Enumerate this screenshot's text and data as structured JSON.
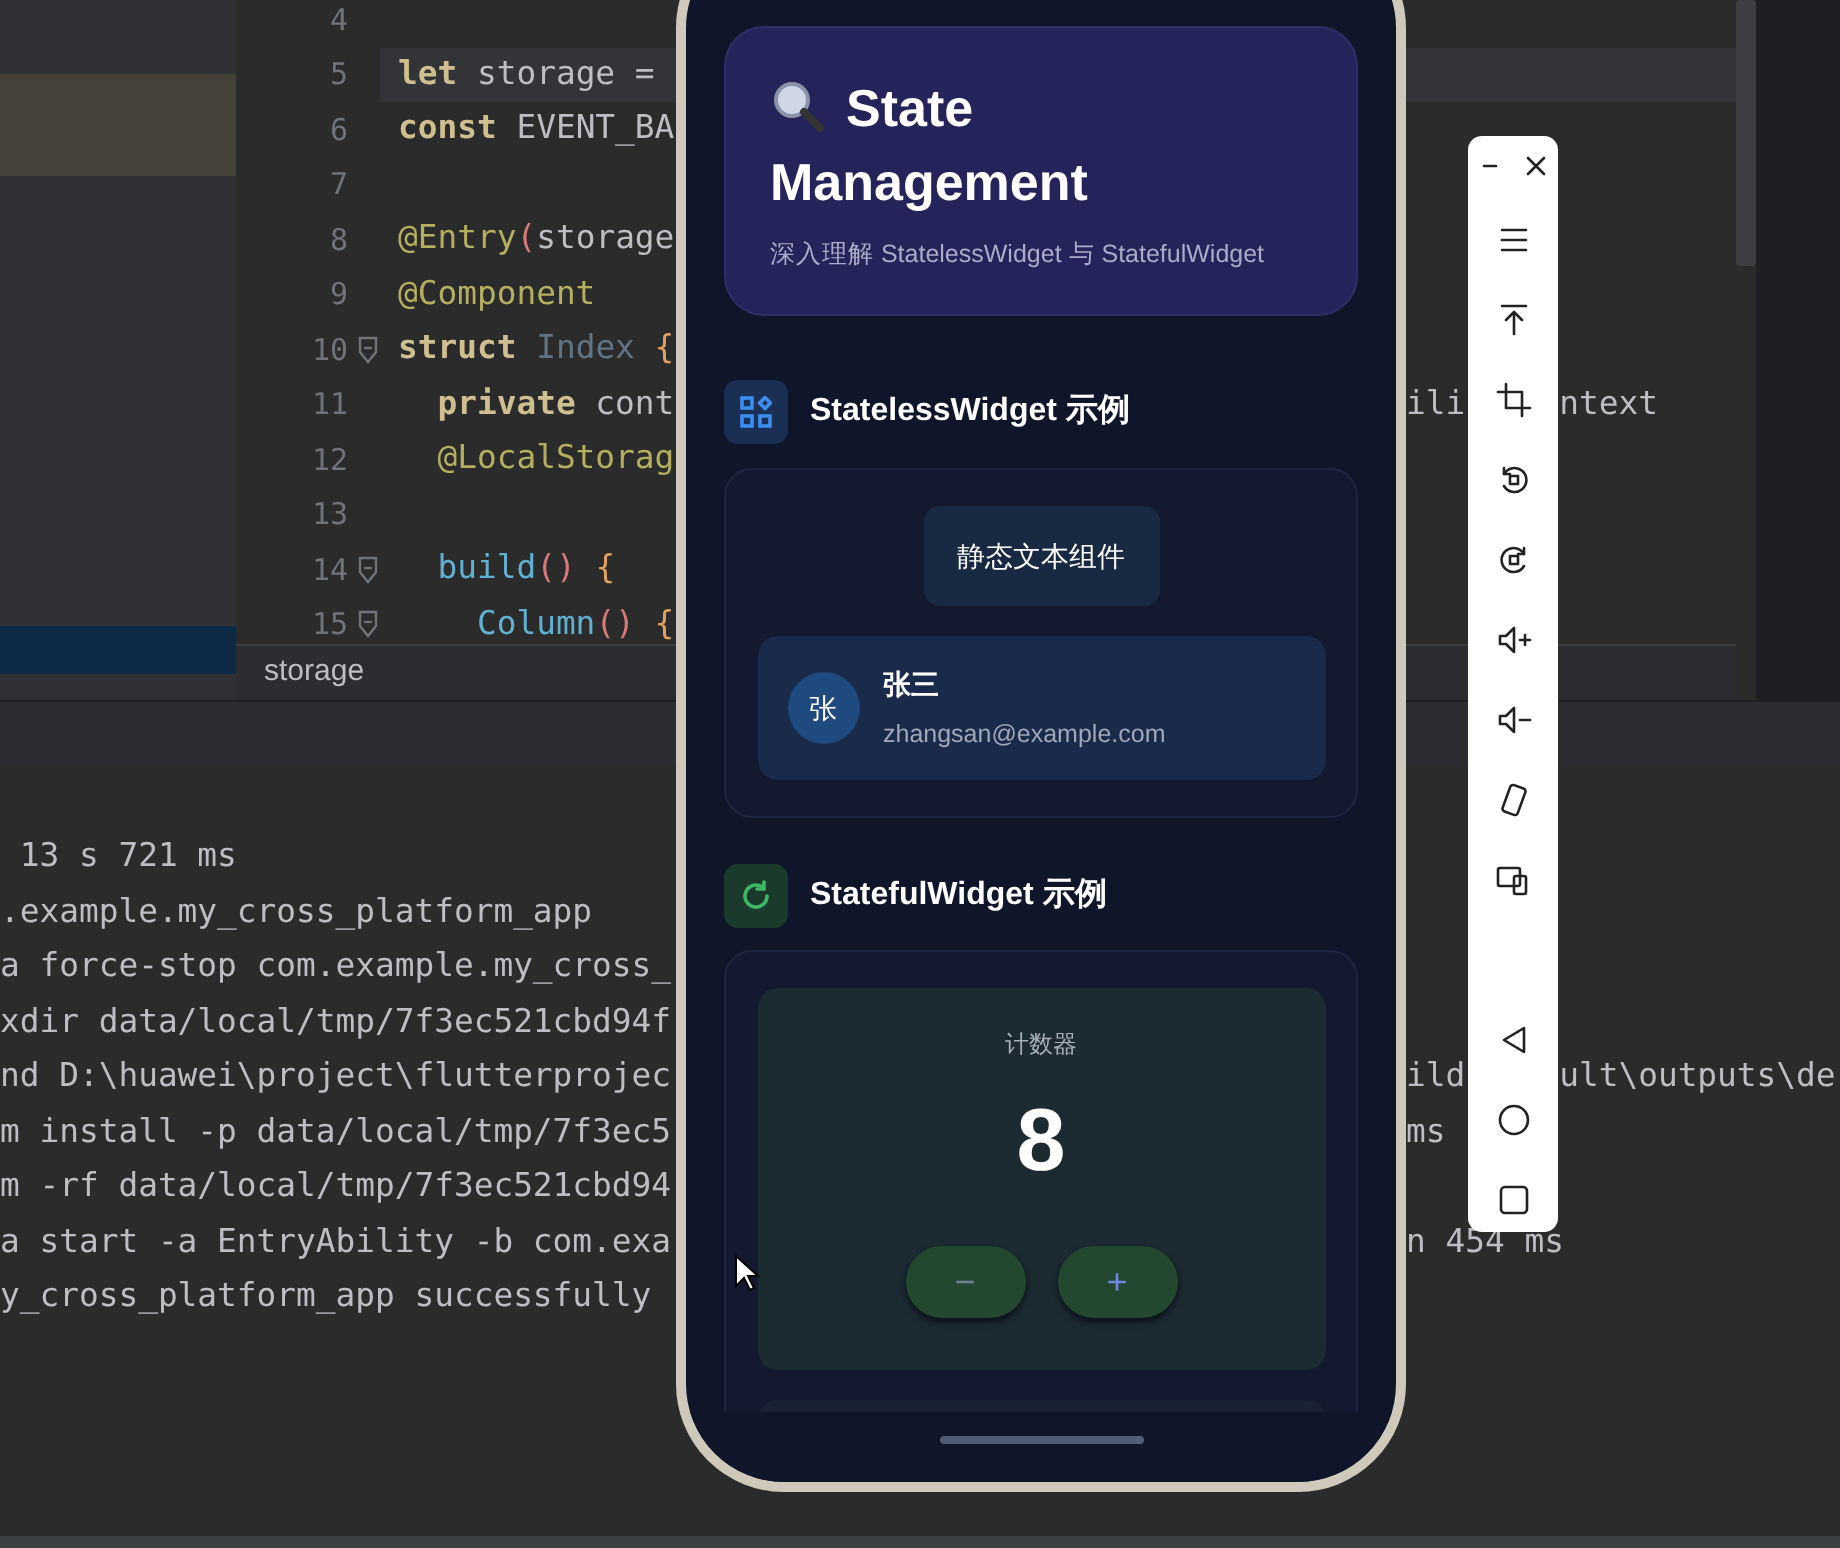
{
  "editor": {
    "lines": [
      {
        "number": "4",
        "current": false
      },
      {
        "number": "5",
        "current": true,
        "tokens": [
          {
            "text": "let",
            "kind": "keyword"
          },
          {
            "text": " storage =",
            "kind": "plain"
          }
        ]
      },
      {
        "number": "6",
        "current": false,
        "tokens": [
          {
            "text": "const",
            "kind": "keyword"
          },
          {
            "text": " EVENT_BA",
            "kind": "plain"
          }
        ]
      },
      {
        "number": "7",
        "current": false
      },
      {
        "number": "8",
        "current": false,
        "tokens": [
          {
            "text": "@Entry",
            "kind": "annotation"
          },
          {
            "text": "(",
            "kind": "paren"
          },
          {
            "text": "storage",
            "kind": "plain"
          }
        ]
      },
      {
        "number": "9",
        "current": false,
        "tokens": [
          {
            "text": "@Component",
            "kind": "annotation"
          }
        ]
      },
      {
        "number": "10",
        "current": false,
        "fold": true,
        "tokens": [
          {
            "text": "struct",
            "kind": "keyword"
          },
          {
            "text": " Index ",
            "kind": "type"
          },
          {
            "text": "{",
            "kind": "brace"
          }
        ]
      },
      {
        "number": "11",
        "current": false,
        "tokens": [
          {
            "text": "  private",
            "kind": "keyword"
          },
          {
            "text": " cont",
            "kind": "plain"
          }
        ],
        "right_parts": [
          "ili",
          "ntext"
        ]
      },
      {
        "number": "12",
        "current": false,
        "tokens": [
          {
            "text": "  @LocalStorag",
            "kind": "annotation"
          }
        ]
      },
      {
        "number": "13",
        "current": false
      },
      {
        "number": "14",
        "current": false,
        "fold": true,
        "tokens": [
          {
            "text": "  build",
            "kind": "function"
          },
          {
            "text": "()",
            "kind": "paren"
          },
          {
            "text": " {",
            "kind": "brace"
          }
        ]
      },
      {
        "number": "15",
        "current": false,
        "fold": true,
        "tokens": [
          {
            "text": "    Column",
            "kind": "function"
          },
          {
            "text": "()",
            "kind": "paren"
          },
          {
            "text": " {",
            "kind": "brace"
          }
        ]
      }
    ],
    "breadcrumb": "storage"
  },
  "console": {
    "lines": [
      {
        "text": " 13 s 721 ms"
      },
      {
        "text": ".example.my_cross_platform_app"
      },
      {
        "text": "a force-stop com.example.my_cross_"
      },
      {
        "text": "xdir data/local/tmp/7f3ec521cbd94f"
      },
      {
        "text": "nd D:\\huawei\\project\\flutterprojec",
        "right_parts": [
          "ild",
          "ult\\outputs\\de"
        ]
      },
      {
        "text": "m install -p data/local/tmp/7f3ec5",
        "right_parts": [
          "ms"
        ]
      },
      {
        "text": "m -rf data/local/tmp/7f3ec521cbd94"
      },
      {
        "text": "a start -a EntryAbility -b com.exa",
        "right_parts": [
          "n 454 ms"
        ]
      },
      {
        "text": "y_cross_platform_app successfully"
      }
    ]
  },
  "phone": {
    "header": {
      "title": "State Management",
      "subtitle": "深入理解 StatelessWidget 与 StatefulWidget"
    },
    "stateless": {
      "title": "StatelessWidget 示例",
      "chip": "静态文本组件",
      "user": {
        "avatar": "张",
        "name": "张三",
        "email": "zhangsan@example.com"
      }
    },
    "stateful": {
      "title": "StatefulWidget 示例",
      "counter_label": "计数器",
      "count": "8",
      "buttons": [
        {
          "label": "−",
          "kind": "decrement"
        },
        {
          "label": "+",
          "kind": "increment"
        }
      ]
    }
  }
}
